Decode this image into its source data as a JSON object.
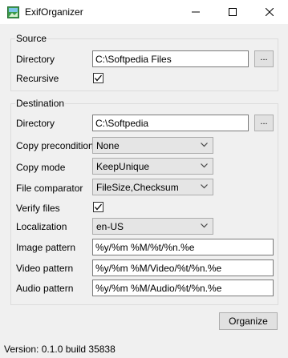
{
  "window": {
    "title": "ExifOrganizer",
    "minimize_glyph": "─",
    "maximize_glyph": "☐",
    "close_glyph": "✕"
  },
  "source": {
    "group_label": "Source",
    "directory_label": "Directory",
    "directory_value": "C:\\Softpedia Files",
    "browse_label": "...",
    "recursive_label": "Recursive",
    "recursive_checked": true
  },
  "destination": {
    "group_label": "Destination",
    "directory_label": "Directory",
    "directory_value": "C:\\Softpedia",
    "browse_label": "...",
    "copy_precondition_label": "Copy precondition",
    "copy_precondition_value": "None",
    "copy_mode_label": "Copy mode",
    "copy_mode_value": "KeepUnique",
    "file_comparator_label": "File comparator",
    "file_comparator_value": "FileSize,Checksum",
    "verify_files_label": "Verify files",
    "verify_files_checked": true,
    "localization_label": "Localization",
    "localization_value": "en-US",
    "image_pattern_label": "Image pattern",
    "image_pattern_value": "%y/%m %M/%t/%n.%e",
    "video_pattern_label": "Video pattern",
    "video_pattern_value": "%y/%m %M/Video/%t/%n.%e",
    "audio_pattern_label": "Audio pattern",
    "audio_pattern_value": "%y/%m %M/Audio/%t/%n.%e"
  },
  "actions": {
    "organize_label": "Organize"
  },
  "status": {
    "version_text": "Version: 0.1.0 build 35838"
  },
  "icons": {
    "app": "app-icon",
    "checkbox": "checkmark-icon",
    "dropdown": "chevron-down-icon"
  },
  "colors": {
    "titlebar": "#ffffff",
    "window_bg": "#f0f0f0",
    "group_border": "#dcdcdc",
    "button_bg": "#e1e1e1"
  }
}
